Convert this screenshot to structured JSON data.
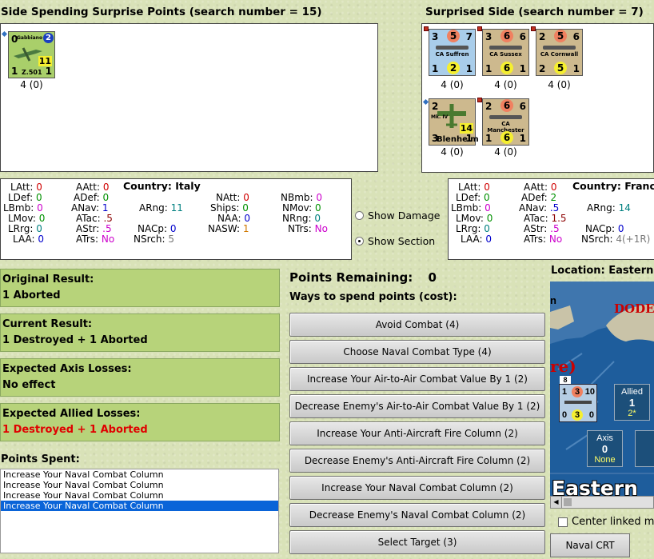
{
  "left_header": "Side Spending Surprise Points (search number = 15)",
  "right_header": "Surprised Side (search number = 7)",
  "spending_units": [
    {
      "tl": "0",
      "tr": "2",
      "name": "Gabbiano",
      "sub": "Z.501",
      "mid": "11",
      "bl": "1",
      "br": "1",
      "label": "4 (0)"
    }
  ],
  "surprised_units": [
    {
      "tl": "3",
      "tm": "5",
      "tr": "7",
      "name": "CA Suffren",
      "bl": "1",
      "bm": "2",
      "br": "1",
      "label": "4 (0)"
    },
    {
      "tl": "3",
      "tm": "6",
      "tr": "6",
      "name": "CA Sussex",
      "bl": "1",
      "bm": "6",
      "br": "1",
      "label": "4 (0)"
    },
    {
      "tl": "2",
      "tm": "5",
      "tr": "6",
      "name": "CA Cornwall",
      "bl": "2",
      "bm": "5",
      "br": "1",
      "label": "4 (0)"
    },
    {
      "tl": "2",
      "tr": "",
      "name": "Mk. IV",
      "sub": "Blenheim",
      "mid": "14",
      "bl": "3",
      "br": "1",
      "label": "4 (0)"
    },
    {
      "tl": "2",
      "tm": "6",
      "tr": "6",
      "name": "CA Manchester",
      "bl": "1",
      "bm": "6",
      "br": "1",
      "label": "4 (0)"
    }
  ],
  "left_stats": {
    "country_label": "Country:",
    "country": "Italy",
    "LAtt": "0",
    "AAtt": "0",
    "LDef": "0",
    "ADef": "0",
    "LBmb": "0",
    "ANav": "1",
    "ARng": "11",
    "LMov": "0",
    "ATac": ".5",
    "LRrg": "0",
    "AStr": ".5",
    "NACp": "0",
    "LAA": "0",
    "ATrs": "No",
    "NSrch": "5",
    "NAtt": "0",
    "NBmb": "0",
    "Ships": "0",
    "NMov": "0",
    "NAA": "0",
    "NRng": "0",
    "NASW": "1",
    "NTrs": "No"
  },
  "right_stats": {
    "country_label": "Country:",
    "country": "France",
    "LAtt": "0",
    "AAtt": "0",
    "LDef": "0",
    "ADef": "2",
    "LBmb": "0",
    "ANav": ".5",
    "ARng": "14",
    "LMov": "0",
    "ATac": "1.5",
    "LRrg": "0",
    "AStr": ".5",
    "NACp": "0",
    "LAA": "0",
    "ATrs": "No",
    "NSrch": "4(+1R)"
  },
  "show_damage_label": "Show Damage",
  "show_section_label": "Show Section",
  "original_result": {
    "title": "Original Result:",
    "value": "1 Aborted"
  },
  "current_result": {
    "title": "Current Result:",
    "value": "1 Destroyed + 1 Aborted"
  },
  "axis_losses": {
    "title": "Expected Axis Losses:",
    "value": "No effect"
  },
  "allied_losses": {
    "title": "Expected Allied Losses:",
    "value": "1 Destroyed + 1 Aborted"
  },
  "points_spent_label": "Points Spent:",
  "points_spent": [
    "Increase Your Naval Combat Column",
    "Increase Your Naval Combat Column",
    "Increase Your Naval Combat Column",
    "Increase Your Naval Combat Column"
  ],
  "points_remaining_label": "Points Remaining:",
  "points_remaining": "0",
  "ways_label": "Ways to spend points (cost):",
  "buttons": [
    "Avoid Combat (4)",
    "Choose Naval Combat Type (4)",
    "Increase Your Air-to-Air Combat Value By 1 (2)",
    "Decrease Enemy's Air-to-Air Combat Value By 1 (2)",
    "Increase Your Anti-Aircraft Fire Column (2)",
    "Decrease Enemy's Anti-Aircraft Fire Column (2)",
    "Increase Your Naval Combat Column (2)",
    "Decrease Enemy's Naval Combat Column (2)",
    "Select Target (3)"
  ],
  "location_label": "Location: Eastern",
  "map": {
    "region_text": "DODE",
    "partial_text": "re)",
    "n_text": "n",
    "unit_top": "8",
    "unit_a": "1",
    "unit_b": "3",
    "unit_c": "10",
    "unit_d": "0",
    "unit_e": "3",
    "unit_f": "0",
    "allied_label": "Allied",
    "allied_value": "1",
    "allied_sub": "2*",
    "axis_label": "Axis",
    "axis_value": "0",
    "axis_sub": "None",
    "sea_name": "Eastern"
  },
  "center_linked_label": "Center linked m",
  "naval_crt_label": "Naval CRT"
}
